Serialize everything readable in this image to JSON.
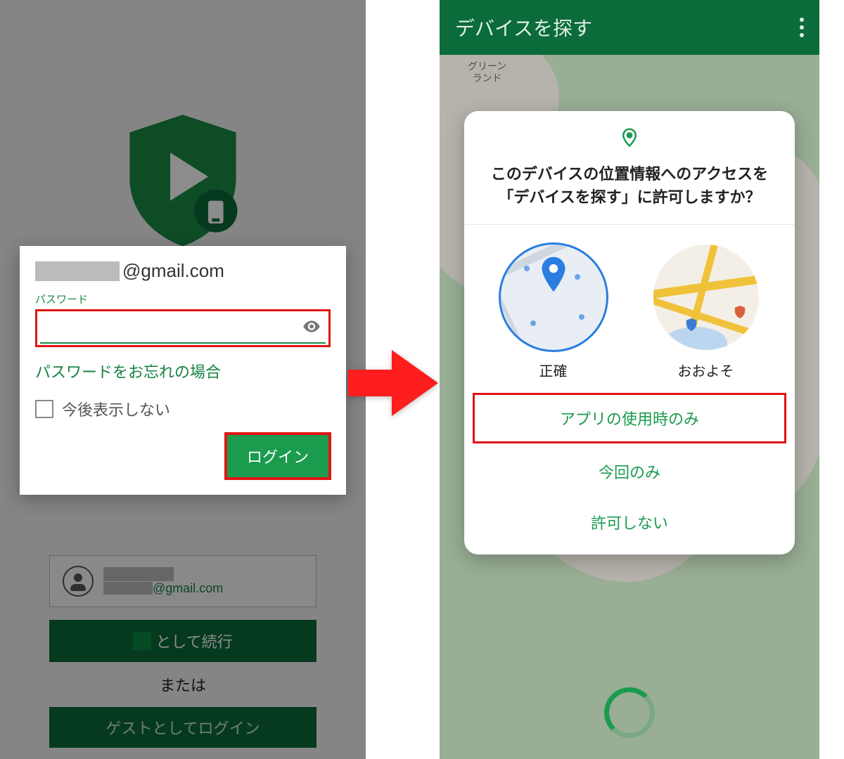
{
  "left": {
    "email_domain": "@gmail.com",
    "password_label": "パスワード",
    "forgot": "パスワードをお忘れの場合",
    "dont_show": "今後表示しない",
    "login": "ログイン",
    "continue_as_suffix": "として続行",
    "or": "または",
    "guest_login": "ゲストとしてログイン",
    "account_email_domain": "@gmail.com"
  },
  "right": {
    "appbar_title": "デバイスを探す",
    "map_label_greenland_1": "グリーン",
    "map_label_greenland_2": "ランド",
    "perm_title": "このデバイスの位置情報へのアクセスを「デバイスを探す」に許可しますか？",
    "precise": "正確",
    "approx": "おおよそ",
    "opt_while_using": "アプリの使用時のみ",
    "opt_once": "今回のみ",
    "opt_deny": "許可しない"
  }
}
